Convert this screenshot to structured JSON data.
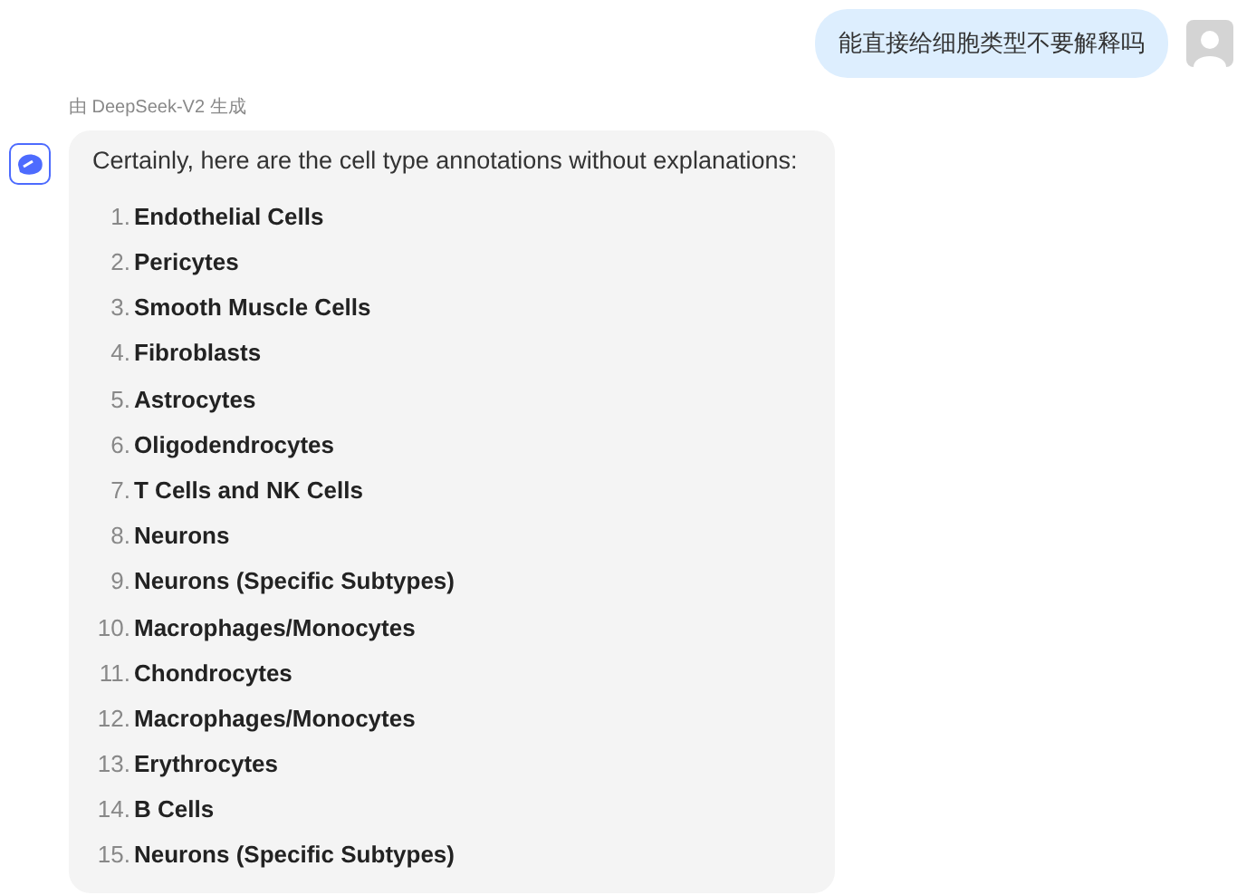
{
  "user_message": {
    "text": "能直接给细胞类型不要解释吗"
  },
  "bot_message": {
    "caption": "由 DeepSeek-V2 生成",
    "intro": "Certainly, here are the cell type annotations without explanations:",
    "items": [
      {
        "number": "1.",
        "text": "Endothelial Cells"
      },
      {
        "number": "2.",
        "text": "Pericytes"
      },
      {
        "number": "3.",
        "text": "Smooth Muscle Cells"
      },
      {
        "number": "4.",
        "text": "Fibroblasts"
      },
      {
        "number": "5.",
        "text": "Astrocytes"
      },
      {
        "number": "6.",
        "text": "Oligodendrocytes"
      },
      {
        "number": "7.",
        "text": "T Cells and NK Cells"
      },
      {
        "number": "8.",
        "text": "Neurons"
      },
      {
        "number": "9.",
        "text": "Neurons (Specific Subtypes)"
      },
      {
        "number": "10.",
        "text": "Macrophages/Monocytes"
      },
      {
        "number": "11.",
        "text": "Chondrocytes"
      },
      {
        "number": "12.",
        "text": "Macrophages/Monocytes"
      },
      {
        "number": "13.",
        "text": "Erythrocytes"
      },
      {
        "number": "14.",
        "text": "B Cells"
      },
      {
        "number": "15.",
        "text": "Neurons (Specific Subtypes)"
      }
    ]
  }
}
